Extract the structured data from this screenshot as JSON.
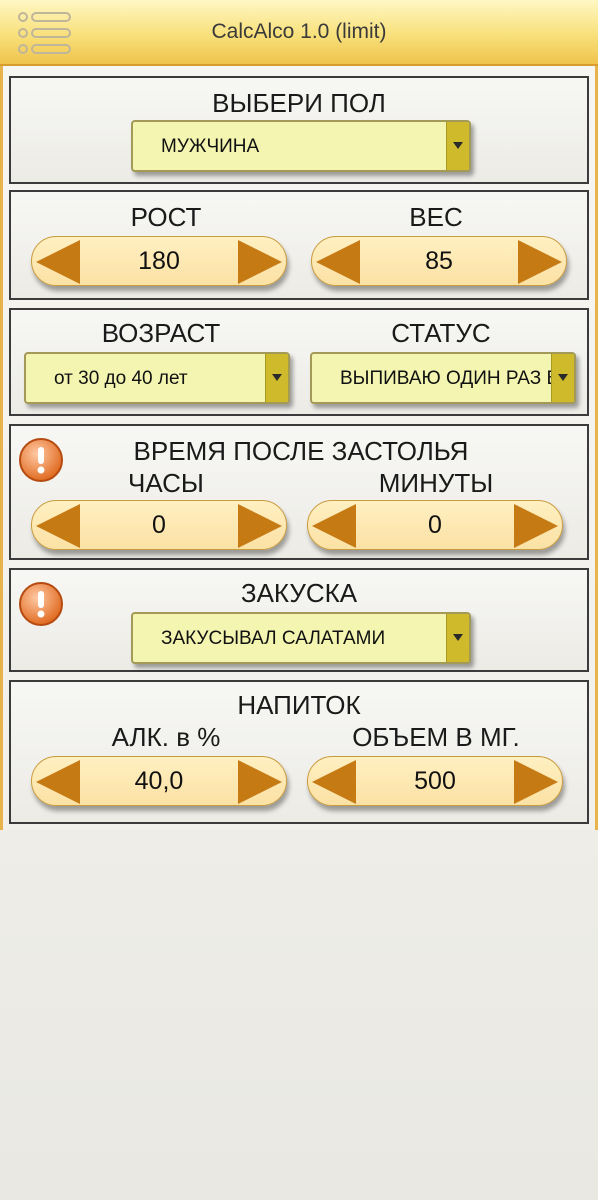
{
  "app": {
    "title": "CalcAlco 1.0 (limit)"
  },
  "gender": {
    "label": "ВЫБЕРИ ПОЛ",
    "value": "МУЖЧИНА"
  },
  "height": {
    "label": "РОСТ",
    "value": "180"
  },
  "weight": {
    "label": "ВЕС",
    "value": "85"
  },
  "age": {
    "label": "ВОЗРАСТ",
    "value": "от 30 до 40 лет"
  },
  "status": {
    "label": "СТАТУС",
    "value": "ВЫПИВАЮ ОДИН РАЗ В"
  },
  "time_after": {
    "label": "ВРЕМЯ ПОСЛЕ ЗАСТОЛЬЯ",
    "hours_label": "ЧАСЫ",
    "hours_value": "0",
    "minutes_label": "МИНУТЫ",
    "minutes_value": "0"
  },
  "snack": {
    "label": "ЗАКУСКА",
    "value": "ЗАКУСЫВАЛ САЛАТАМИ"
  },
  "drink": {
    "label": "НАПИТОК",
    "alc_label": "АЛК. в %",
    "alc_value": "40,0",
    "volume_label": "ОБЪЕМ В МГ.",
    "volume_value": "500"
  },
  "colors": {
    "accent": "#c67a14",
    "title_bar": "#f8e07a",
    "select_bg": "#f3f5b0",
    "warning": "#e87a2a"
  },
  "icons": {
    "menu": "menu-list-icon",
    "warning": "exclamation-icon"
  }
}
